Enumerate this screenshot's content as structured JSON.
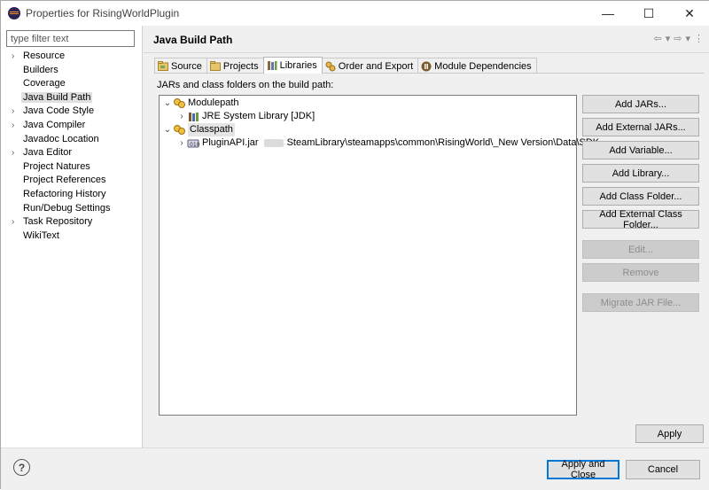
{
  "window": {
    "title": "Properties for RisingWorldPlugin",
    "minimize": "—",
    "maximize": "☐",
    "close": "✕"
  },
  "sidebar": {
    "filter_placeholder": "type filter text",
    "items": [
      {
        "label": "Resource",
        "expandable": true
      },
      {
        "label": "Builders",
        "expandable": false
      },
      {
        "label": "Coverage",
        "expandable": false
      },
      {
        "label": "Java Build Path",
        "expandable": false,
        "selected": true
      },
      {
        "label": "Java Code Style",
        "expandable": true
      },
      {
        "label": "Java Compiler",
        "expandable": true
      },
      {
        "label": "Javadoc Location",
        "expandable": false
      },
      {
        "label": "Java Editor",
        "expandable": true
      },
      {
        "label": "Project Natures",
        "expandable": false
      },
      {
        "label": "Project References",
        "expandable": false
      },
      {
        "label": "Refactoring History",
        "expandable": false
      },
      {
        "label": "Run/Debug Settings",
        "expandable": false
      },
      {
        "label": "Task Repository",
        "expandable": true
      },
      {
        "label": "WikiText",
        "expandable": false
      }
    ]
  },
  "page": {
    "title": "Java Build Path",
    "tabs": [
      {
        "label": "Source",
        "icon": "source-folder-icon"
      },
      {
        "label": "Projects",
        "icon": "projects-icon"
      },
      {
        "label": "Libraries",
        "icon": "libraries-icon",
        "active": true
      },
      {
        "label": "Order and Export",
        "icon": "order-export-icon"
      },
      {
        "label": "Module Dependencies",
        "icon": "module-icon"
      }
    ],
    "description": "JARs and class folders on the build path:",
    "tree": {
      "modulepath": "Modulepath",
      "jre": "JRE System Library [JDK]",
      "classpath": "Classpath",
      "jar_name": "PluginAPI.jar",
      "jar_path": "SteamLibrary\\steamapps\\common\\RisingWorld\\_New Version\\Data\\SDK"
    },
    "buttons": {
      "add_jars": "Add JARs...",
      "add_external_jars": "Add External JARs...",
      "add_variable": "Add Variable...",
      "add_library": "Add Library...",
      "add_class_folder": "Add Class Folder...",
      "add_external_class_folder": "Add External Class Folder...",
      "edit": "Edit...",
      "remove": "Remove",
      "migrate_jar": "Migrate JAR File...",
      "apply": "Apply"
    }
  },
  "footer": {
    "help": "?",
    "apply_and_close": "Apply and Close",
    "cancel": "Cancel"
  }
}
